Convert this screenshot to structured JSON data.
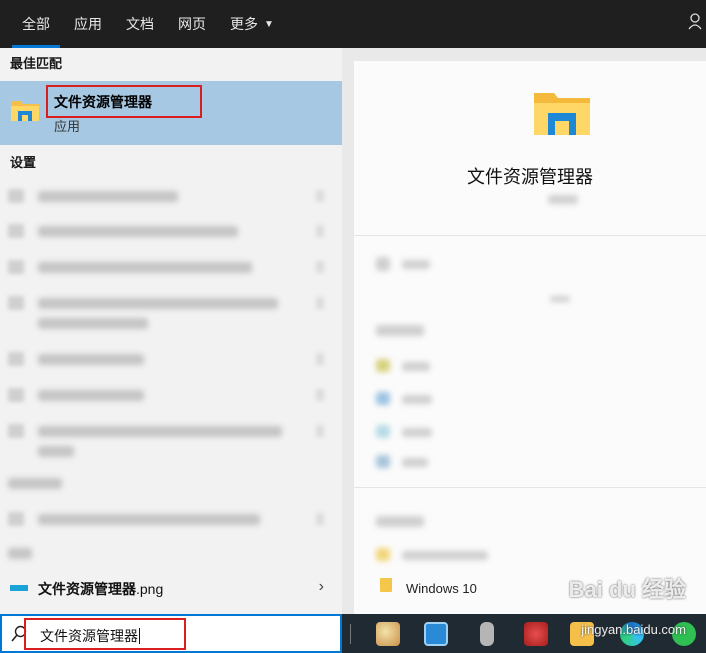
{
  "tabs": [
    {
      "label": "全部",
      "active": true
    },
    {
      "label": "应用",
      "active": false
    },
    {
      "label": "文档",
      "active": false
    },
    {
      "label": "网页",
      "active": false
    },
    {
      "label": "更多",
      "active": false
    }
  ],
  "left": {
    "best_match_header": "最佳匹配",
    "best_match": {
      "name": "文件资源管理器",
      "kind": "应用"
    },
    "settings_header": "设置",
    "file_result": {
      "name_bold": "文件资源管理器",
      "name_ext": ".png"
    }
  },
  "right": {
    "title": "文件资源管理器",
    "recent_item": "Windows 10"
  },
  "search": {
    "query": "文件资源管理器"
  },
  "watermark": {
    "brand": "Bai du 经验",
    "url": "jingyan.baidu.com"
  },
  "colors": {
    "accent": "#0078d7",
    "highlight": "#a7c8e3",
    "annotation": "#d81e1e"
  }
}
